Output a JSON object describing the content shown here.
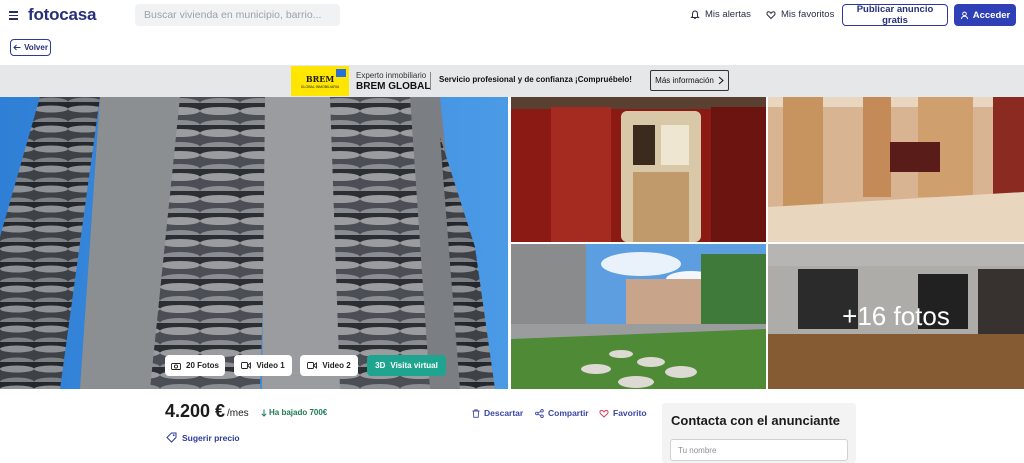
{
  "header": {
    "logo": "fotocasa",
    "search_placeholder": "Buscar vivienda en municipio, barrio...",
    "alerts": "Mis alertas",
    "favorites": "Mis favoritos",
    "publish": "Publicar anuncio gratis",
    "login": "Acceder"
  },
  "back_label": "Volver",
  "ad": {
    "logo_text": "BREM",
    "logo_subtext": "GLOBAL INMOBILIARIA",
    "subtitle": "Experto inmobiliario",
    "agency": "BREM GLOBAL",
    "slogan": "Servicio profesional y de confianza ¡Compruébelo!",
    "more_info": "Más información"
  },
  "gallery": {
    "more_photos": "+16 fotos",
    "buttons": {
      "photos": "20 Fotos",
      "video1": "Video 1",
      "video2": "Video 2",
      "virtual_tag": "3D",
      "virtual": "Visita virtual"
    }
  },
  "listing": {
    "price": "4.200 €",
    "price_unit": "/mes",
    "price_drop": "Ha bajado 700€",
    "discard": "Descartar",
    "share": "Compartir",
    "favorite": "Favorito",
    "suggest_price": "Sugerir precio"
  },
  "contact": {
    "title": "Contacta con el anunciante",
    "name_placeholder": "Tu nombre"
  },
  "colors": {
    "brand": "#26307a",
    "primary_button": "#2f3fb5",
    "virtual_tour": "#1fa58f",
    "price_drop": "#1d7b55",
    "favorite": "#d6435f"
  }
}
